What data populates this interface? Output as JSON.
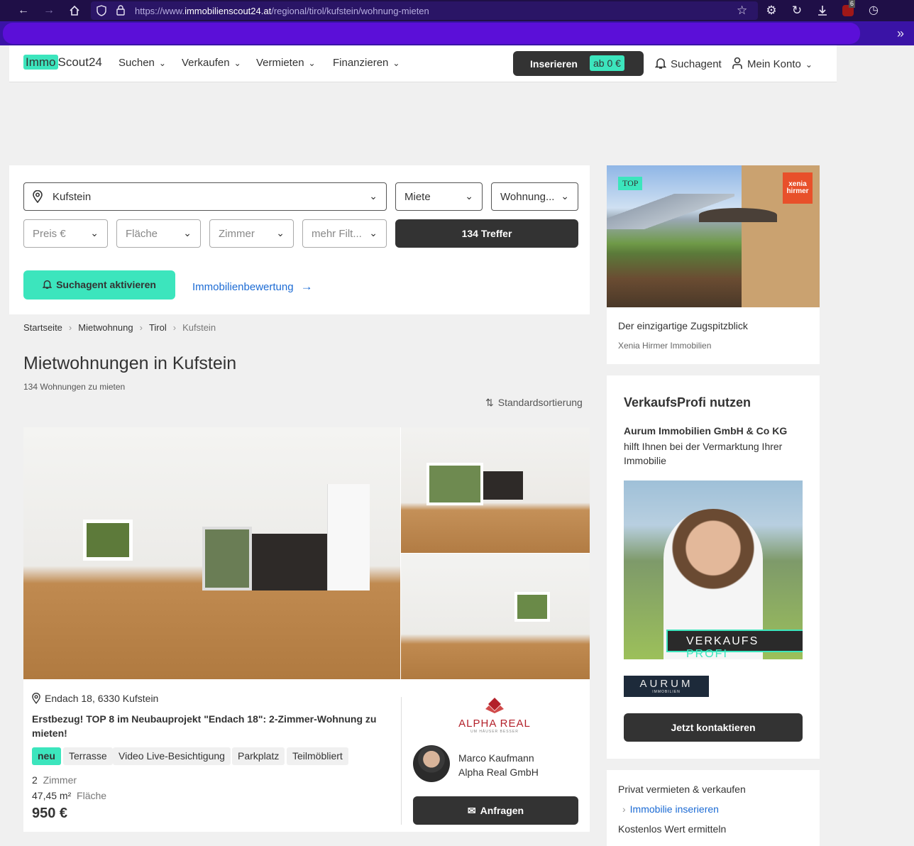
{
  "browser": {
    "url_prefix": "https://www.",
    "url_domain": "immobilienscout24.at",
    "url_path": "/regional/tirol/kufstein/wohnung-mieten",
    "extension_badge": "6"
  },
  "header": {
    "logo_immo": "Immo",
    "logo_scout": "Scout24",
    "menu": [
      "Suchen",
      "Verkaufen",
      "Vermieten",
      "Finanzieren"
    ],
    "inserieren_label": "Inserieren",
    "inserieren_badge": "ab 0 €",
    "suchagent": "Suchagent",
    "mein_konto": "Mein Konto"
  },
  "search": {
    "location": "Kufstein",
    "type": "Miete",
    "category": "Wohnung...",
    "filters": [
      "Preis €",
      "Fläche",
      "Zimmer",
      "mehr Filt..."
    ],
    "results_button": "134 Treffer",
    "suchagent_button": "Suchagent aktivieren",
    "bewertung_link": "Immobilienbewertung"
  },
  "breadcrumb": [
    "Startseite",
    "Mietwohnung",
    "Tirol",
    "Kufstein"
  ],
  "page": {
    "title": "Mietwohnungen in Kufstein",
    "count": "134 Wohnungen zu mieten",
    "sort": "Standardsortierung"
  },
  "listing": {
    "address": "Endach 18, 6330 Kufstein",
    "title": "Erstbezug! TOP 8 im Neubauprojekt \"Endach 18\": 2-Zimmer-Wohnung zu mieten!",
    "tags": [
      "neu",
      "Terrasse",
      "Video Live-Besichtigung",
      "Parkplatz",
      "Teilmöbliert"
    ],
    "rooms_value": "2",
    "rooms_label": "Zimmer",
    "area_value": "47,45 m²",
    "area_label": "Fläche",
    "price": "950 €",
    "agency_logo_text": "ALPHA REAL",
    "agency_logo_sub": "UM HÄUSER BESSER",
    "agent_name": "Marco Kaufmann",
    "agent_company": "Alpha Real GmbH",
    "anfragen": "Anfragen"
  },
  "sidebar": {
    "top_badge": "TOP",
    "xenia_logo": "xenia hirmer",
    "top_ad_title": "Der einzigartige Zugspitzblick",
    "top_ad_sub": "Xenia Hirmer Immobilien",
    "vp_title": "VerkaufsProfi nutzen",
    "vp_company": "Aurum Immobilien GmbH & Co KG",
    "vp_desc": "hilft Ihnen bei der Vermarktung Ihrer Immobilie",
    "vp_banner_1": "VERKAUFS",
    "vp_banner_2": "PROFI",
    "aurum_logo": "AURUM",
    "aurum_logo_sub": "IMMOBILIEN",
    "kontakt_button": "Jetzt kontaktieren",
    "links": [
      "Privat vermieten & verkaufen",
      "Immobilie inserieren",
      "Kostenlos Wert ermitteln"
    ]
  }
}
